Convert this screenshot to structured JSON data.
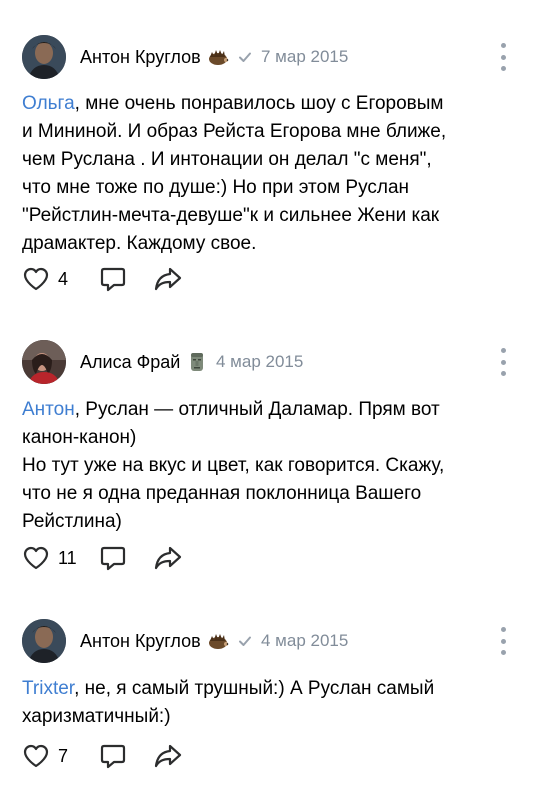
{
  "comments": [
    {
      "author": "Антон Круглов",
      "author_emoji": "hedgehog-icon",
      "verified": true,
      "date": "7 мар 2015",
      "mention": "Ольга",
      "text": ", мне очень понравилось шоу с Егоровым\nи Мининой. И образ Рейста Егорова мне ближе,\nчем Руслана . И интонации он делал \"с меня\",\nчто мне тоже по душе:) Но при этом Руслан\n\"Рейстлин-мечта-девуше\"к и сильнее Жени как\nдрамактер. Каждому свое.",
      "likes": "4"
    },
    {
      "author": "Алиса Фрай",
      "author_emoji": "moai-icon",
      "verified": false,
      "date": "4 мар 2015",
      "mention": "Антон",
      "text": ", Руслан — отличный Даламар. Прям вот\nканон-канон)\nНо тут уже на вкус и цвет, как говорится. Скажу,\nчто не я одна преданная поклонница Вашего\nРейстлина)",
      "likes": "11"
    },
    {
      "author": "Антон Круглов",
      "author_emoji": "hedgehog-icon",
      "verified": true,
      "date": "4 мар 2015",
      "mention": "Trixter",
      "text": ", не, я самый трушный:) А Руслан самый\nхаризматичный:)",
      "likes": "7"
    }
  ],
  "colors": {
    "mention": "#3f7ed1",
    "secondary": "#818c99",
    "icon": "#2c2d2e"
  }
}
